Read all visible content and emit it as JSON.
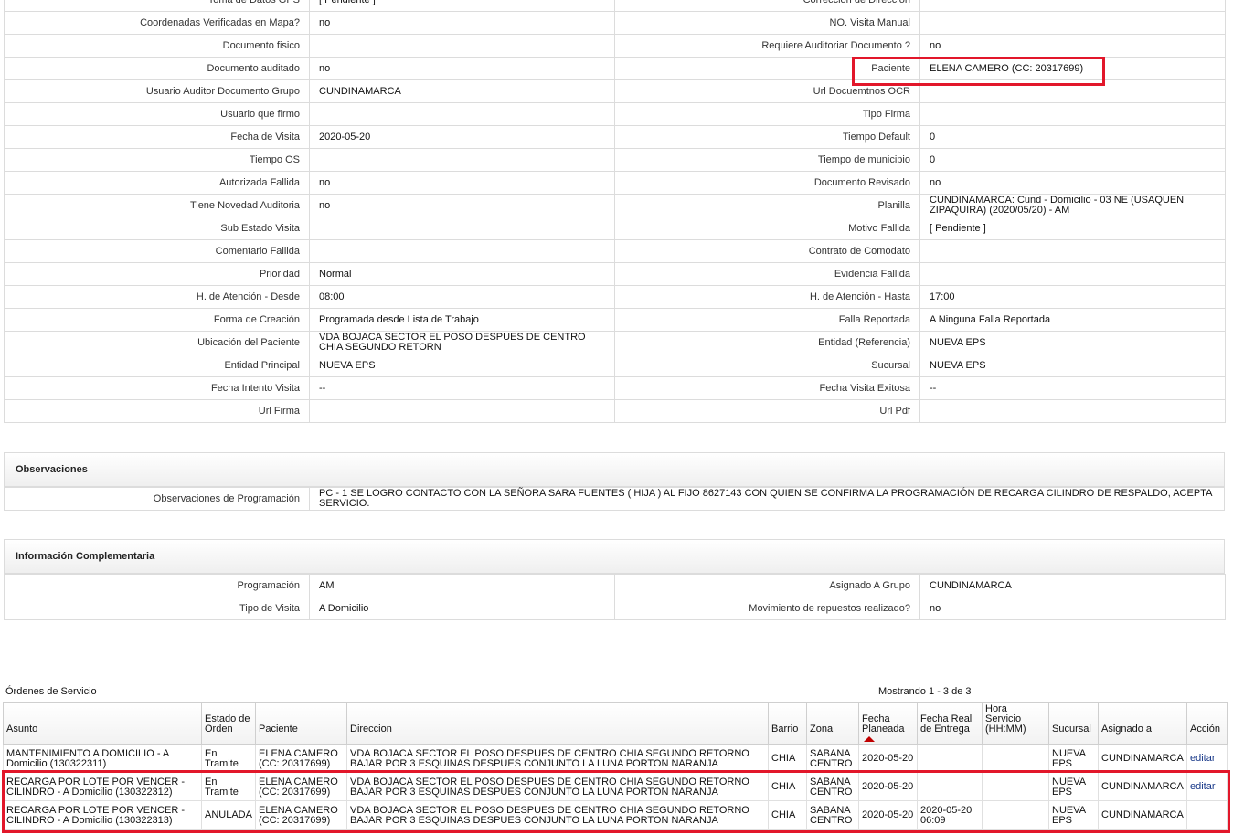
{
  "detail_rows": [
    [
      "Toma de Datos GPS",
      "[ Pendiente ]",
      "Corrección de Dirección",
      ""
    ],
    [
      "Coordenadas Verificadas en Mapa?",
      "no",
      "NO. Visita Manual",
      ""
    ],
    [
      "Documento fisico",
      "",
      "Requiere Auditoriar Documento ?",
      "no"
    ],
    [
      "Documento auditado",
      "no",
      "Paciente",
      "ELENA CAMERO (CC: 20317699)"
    ],
    [
      "Usuario Auditor Documento Grupo",
      "CUNDINAMARCA",
      "Url Docuemtnos OCR",
      ""
    ],
    [
      "Usuario que firmo",
      "",
      "Tipo Firma",
      ""
    ],
    [
      "Fecha de Visita",
      "2020-05-20",
      "Tiempo Default",
      "0"
    ],
    [
      "Tiempo OS",
      "",
      "Tiempo de municipio",
      "0"
    ],
    [
      "Autorizada Fallida",
      "no",
      "Documento Revisado",
      "no"
    ],
    [
      "Tiene Novedad Auditoria",
      "no",
      "Planilla",
      "CUNDINAMARCA: Cund - Domicilio - 03 NE (USAQUEN ZIPAQUIRA) (2020/05/20) - AM"
    ],
    [
      "Sub Estado Visita",
      "",
      "Motivo Fallida",
      "[ Pendiente ]"
    ],
    [
      "Comentario Fallida",
      "",
      "Contrato de Comodato",
      ""
    ],
    [
      "Prioridad",
      "Normal",
      "Evidencia Fallida",
      ""
    ],
    [
      "H. de Atención - Desde",
      "08:00",
      "H. de Atención - Hasta",
      "17:00"
    ],
    [
      "Forma de Creación",
      "Programada desde Lista de Trabajo",
      "Falla Reportada",
      "A Ninguna Falla Reportada"
    ],
    [
      "Ubicación del Paciente",
      "VDA BOJACA SECTOR EL POSO DESPUES DE CENTRO CHIA SEGUNDO RETORN",
      "Entidad (Referencia)",
      "NUEVA EPS"
    ],
    [
      "Entidad Principal",
      "NUEVA EPS",
      "Sucursal",
      "NUEVA EPS"
    ],
    [
      "Fecha Intento Visita",
      "--",
      "Fecha Visita Exitosa",
      "--"
    ],
    [
      "Url Firma",
      "",
      "Url Pdf",
      ""
    ]
  ],
  "observaciones": {
    "title": "Observaciones",
    "label": "Observaciones de Programación",
    "value": " PC - 1 SE LOGRO CONTACTO CON LA SEÑORA SARA FUENTES ( HIJA ) AL FIJO 8627143 CON QUIEN SE CONFIRMA LA PROGRAMACIÓN DE RECARGA CILINDRO DE RESPALDO, ACEPTA SERVICIO."
  },
  "complementaria": {
    "title": "Información Complementaria",
    "rows": [
      [
        "Programación",
        "AM",
        "Asignado A Grupo",
        "CUNDINAMARCA"
      ],
      [
        "Tipo de Visita",
        "A Domicilio",
        "Movimiento de repuestos realizado?",
        "no"
      ]
    ]
  },
  "ordenes": {
    "title": "Órdenes de Servicio",
    "showing": "Mostrando 1 - 3 de 3",
    "headers": [
      "Asunto",
      "Estado de Orden",
      "Paciente",
      "Direccion",
      "Barrio",
      "Zona",
      "Fecha Planeada",
      "Fecha Real de Entrega",
      "Hora Servicio (HH:MM)",
      "Sucursal",
      "Asignado a",
      "Acción"
    ],
    "rows": [
      [
        "MANTENIMIENTO A DOMICILIO - A Domicilio (130322311)",
        "En Tramite",
        "ELENA CAMERO (CC: 20317699)",
        "VDA BOJACA SECTOR EL POSO DESPUES DE CENTRO CHIA SEGUNDO RETORNO BAJAR POR 3 ESQUINAS DESPUES CONJUNTO LA LUNA PORTON NARANJA",
        "CHIA",
        "SABANA CENTRO",
        "2020-05-20",
        "",
        "",
        "NUEVA EPS",
        "CUNDINAMARCA",
        "editar"
      ],
      [
        "RECARGA POR LOTE POR VENCER - CILINDRO - A Domicilio (130322312)",
        "En Tramite",
        "ELENA CAMERO (CC: 20317699)",
        "VDA BOJACA SECTOR EL POSO DESPUES DE CENTRO CHIA SEGUNDO RETORNO BAJAR POR 3 ESQUINAS DESPUES CONJUNTO LA LUNA PORTON NARANJA",
        "CHIA",
        "SABANA CENTRO",
        "2020-05-20",
        "",
        "",
        "NUEVA EPS",
        "CUNDINAMARCA",
        "editar"
      ],
      [
        "RECARGA POR LOTE POR VENCER - CILINDRO - A Domicilio (130322313)",
        "ANULADA",
        "ELENA CAMERO (CC: 20317699)",
        "VDA BOJACA SECTOR EL POSO DESPUES DE CENTRO CHIA SEGUNDO RETORNO BAJAR POR 3 ESQUINAS DESPUES CONJUNTO LA LUNA PORTON NARANJA",
        "CHIA",
        "SABANA CENTRO",
        "2020-05-20",
        "2020-05-20 06:09",
        "",
        "NUEVA EPS",
        "CUNDINAMARCA",
        ""
      ]
    ]
  },
  "colors": {
    "highlight": "#e2172a",
    "sort_arrow": "#c00000",
    "link": "#1a3a8a"
  }
}
